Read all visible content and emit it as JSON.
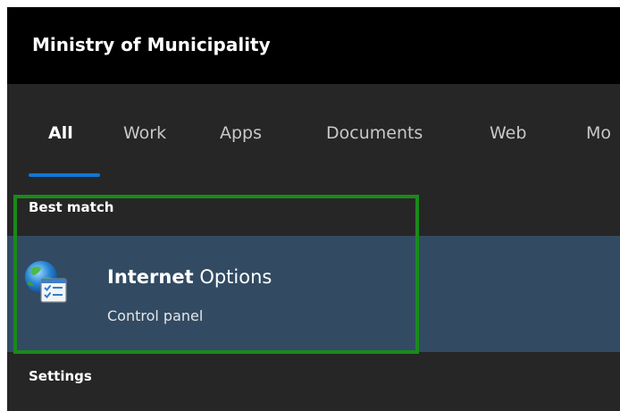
{
  "window": {
    "org_title": "Ministry of Municipality"
  },
  "tabs": [
    {
      "label": "All",
      "active": true
    },
    {
      "label": "Work",
      "active": false
    },
    {
      "label": "Apps",
      "active": false
    },
    {
      "label": "Documents",
      "active": false
    },
    {
      "label": "Web",
      "active": false
    },
    {
      "label": "Mo",
      "active": false
    }
  ],
  "best_match": {
    "section_label": "Best match",
    "result": {
      "title_match": "Internet",
      "title_rest": " Options",
      "subtitle": "Control panel",
      "icon": "internet-options-icon"
    }
  },
  "settings": {
    "section_label": "Settings"
  },
  "colors": {
    "accent": "#0f78d4",
    "selection_bg": "#324b63",
    "highlight_border": "#1a8a1a",
    "panel_bg": "#262626",
    "titlebar_bg": "#000000"
  }
}
